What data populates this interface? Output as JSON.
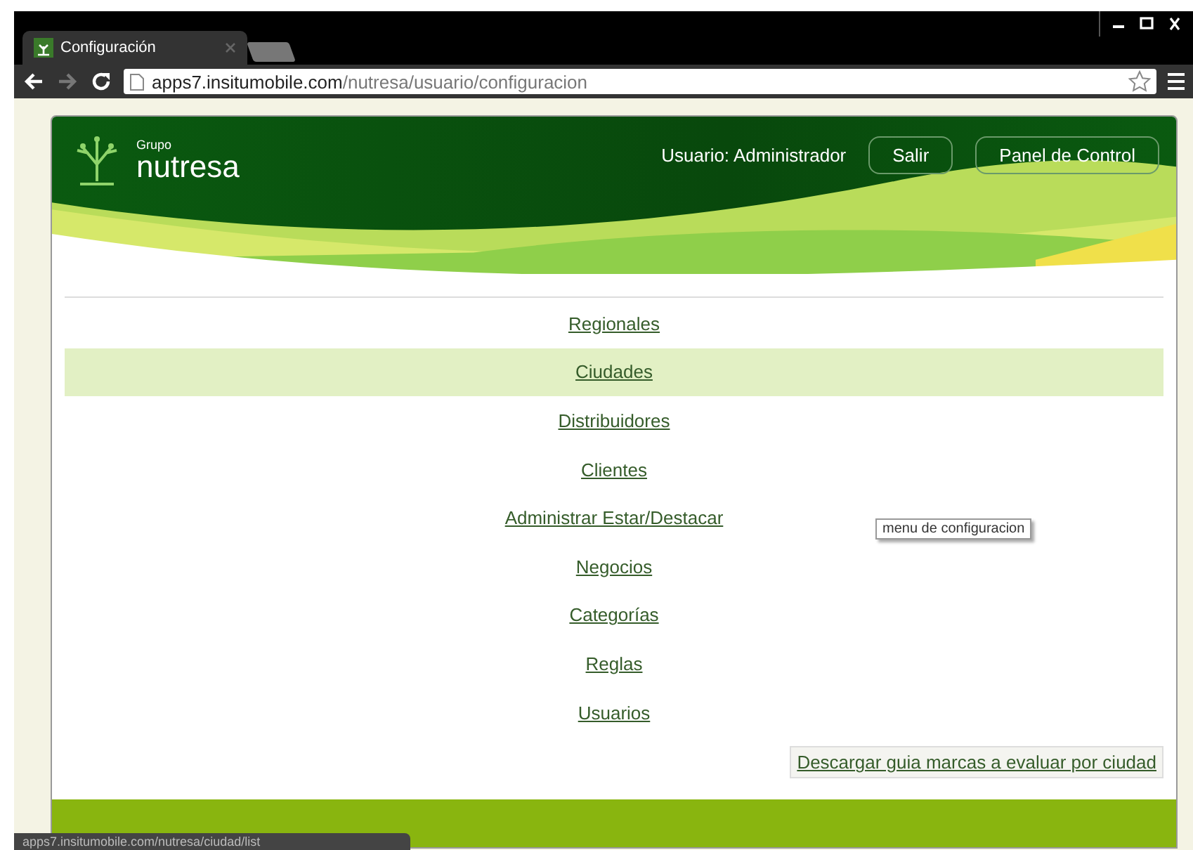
{
  "browser": {
    "tabs": [
      {
        "kind": "page",
        "title": "Configuración",
        "selected": true
      },
      {
        "kind": "new",
        "selected": false
      }
    ],
    "address": {
      "host": "apps7.insitumobile.com",
      "path": "/nutresa/usuario/configuracion"
    }
  },
  "header": {
    "logo_small": "Grupo",
    "logo_large": "nutresa",
    "user": "Usuario: Administrador",
    "buttons": [
      "Salir",
      "Panel de Control"
    ]
  },
  "menu": [
    {
      "label": "Regionales",
      "selected": false
    },
    {
      "label": "Ciudades",
      "selected": true
    },
    {
      "label": "Distribuidores",
      "selected": false
    },
    {
      "label": "Clientes",
      "selected": false
    },
    {
      "label": "Administrar Estar/Destacar",
      "selected": false
    },
    {
      "label": "Negocios",
      "selected": false
    },
    {
      "label": "Categorías",
      "selected": false
    },
    {
      "label": "Reglas",
      "selected": false
    },
    {
      "label": "Usuarios",
      "selected": false
    }
  ],
  "tooltip": "menu de configuracion",
  "download_link": "Descargar guia marcas a evaluar por ciudad",
  "status_url": "apps7.insitumobile.com/nutresa/ciudad/list"
}
